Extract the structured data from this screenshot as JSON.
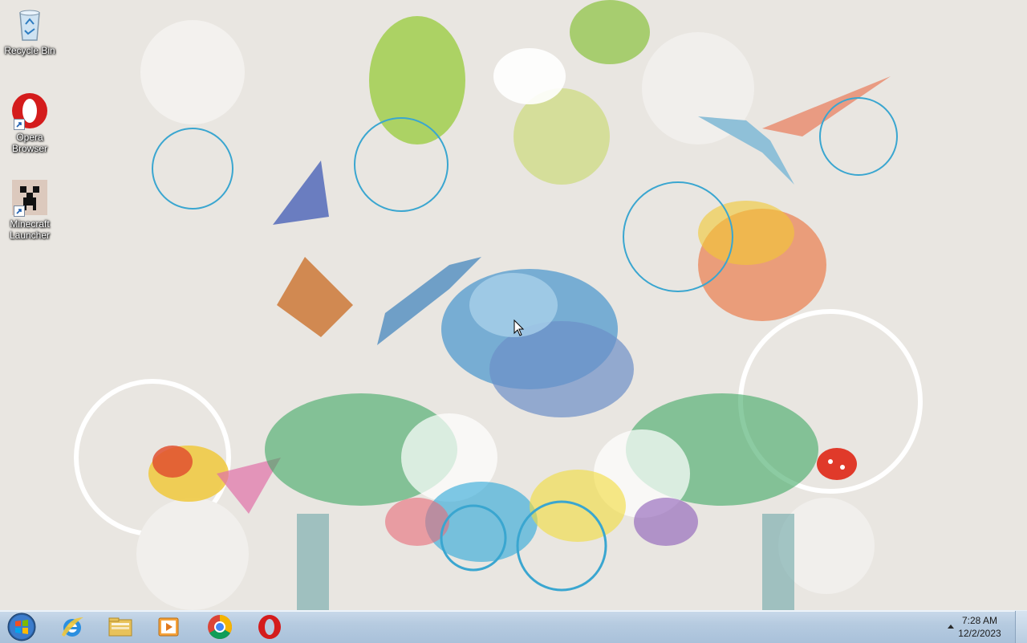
{
  "desktop": {
    "icons": [
      {
        "label": "Recycle Bin",
        "icon": "recycle-bin-icon"
      },
      {
        "label": "Opera Browser",
        "icon": "opera-icon"
      },
      {
        "label": "Minecraft Launcher",
        "icon": "minecraft-icon"
      }
    ]
  },
  "taskbar": {
    "start": {
      "icon": "windows-start-icon"
    },
    "pinned": [
      {
        "icon": "internet-explorer-icon"
      },
      {
        "icon": "file-explorer-icon"
      },
      {
        "icon": "media-player-icon"
      },
      {
        "icon": "chrome-icon"
      },
      {
        "icon": "opera-icon"
      }
    ],
    "tray": {
      "time": "7:28 AM",
      "date": "12/2/2023",
      "expand_icon": "chevron-up-icon"
    }
  },
  "colors": {
    "taskbar": "#b6cbe0",
    "opera_red": "#d41c1c",
    "wallpaper_bg": "#e9e6e1"
  }
}
